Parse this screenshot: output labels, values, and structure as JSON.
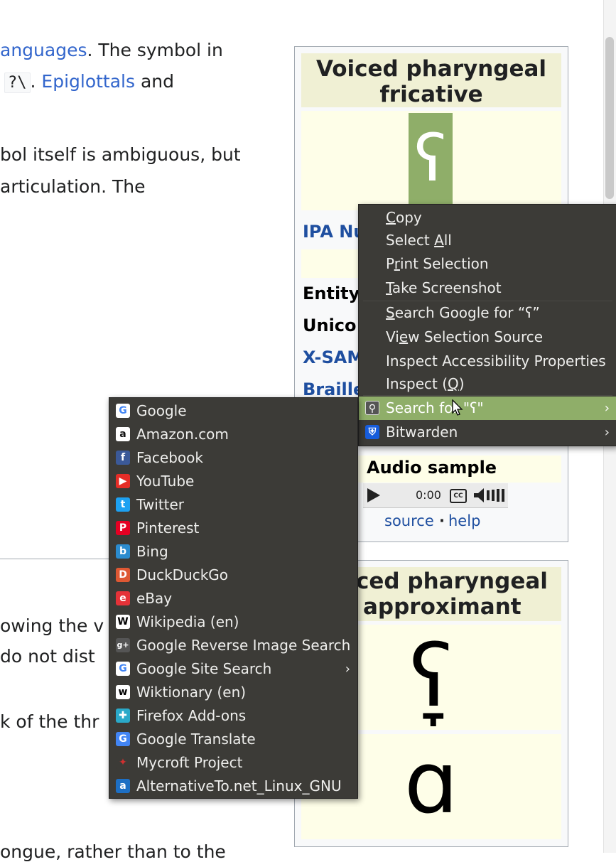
{
  "article": {
    "line1_link": "anguages",
    "line1_rest": ". The symbol in",
    "line2_code": "?\\",
    "line2_sep": ".",
    "line2_link": "Epiglottals",
    "line2_rest": "and",
    "line3": "bol itself is ambiguous, but",
    "line4": "articulation. The",
    "line5": "owing the v",
    "line6": "do not dist",
    "line7": "k of the thr",
    "line8": "ongue, rather than to the"
  },
  "infobox1": {
    "title": "Voiced pharyngeal fricative",
    "glyph": "ʕ",
    "labels": {
      "ipa_number": "IPA Nu",
      "entity": "Entity",
      "unicode": "Unico",
      "xsampa": "X-SAM",
      "braille": "Braille"
    },
    "audio_title": "Audio sample",
    "audio_time": "0:00",
    "audio_cc": "CC",
    "source": "source",
    "dot": "·",
    "help": "help"
  },
  "infobox2": {
    "title_line1": "ced pharyngeal",
    "title_line2": "approximant",
    "glyph1": "ʕ̞",
    "glyph2": "ɑ"
  },
  "context_menu": {
    "items": [
      {
        "prefix": "",
        "u": "C",
        "suffix": "opy"
      },
      {
        "prefix": "Select ",
        "u": "A",
        "suffix": "ll"
      },
      {
        "prefix": "P",
        "u": "r",
        "suffix": "int Selection"
      },
      {
        "prefix": "",
        "u": "T",
        "suffix": "ake Screenshot"
      },
      {
        "prefix": "",
        "u": "S",
        "suffix": "earch Google for “ʕ”"
      },
      {
        "prefix": "Vi",
        "u": "e",
        "suffix": "w Selection Source"
      },
      {
        "prefix": "Inspect Accessibility Properties",
        "u": "",
        "suffix": ""
      },
      {
        "prefix": "Inspect (",
        "u": "Q",
        "suffix": ")"
      }
    ],
    "search_for": "Search for \"ʕ\"",
    "bitwarden": "Bitwarden",
    "arrow": "›"
  },
  "search_submenu": {
    "engines": [
      {
        "label": "Google",
        "icon": "google-icon",
        "glyph": "G",
        "color": "#ffffff",
        "fg": "#4285f4"
      },
      {
        "label": "Amazon.com",
        "icon": "amazon-icon",
        "glyph": "a",
        "color": "#ffffff",
        "fg": "#111111"
      },
      {
        "label": "Facebook",
        "icon": "facebook-icon",
        "glyph": "f",
        "color": "#3b5998",
        "fg": "#ffffff"
      },
      {
        "label": "YouTube",
        "icon": "youtube-icon",
        "glyph": "▶",
        "color": "#e52d27",
        "fg": "#ffffff"
      },
      {
        "label": "Twitter",
        "icon": "twitter-icon",
        "glyph": "t",
        "color": "#1da1f2",
        "fg": "#ffffff"
      },
      {
        "label": "Pinterest",
        "icon": "pinterest-icon",
        "glyph": "P",
        "color": "#e60023",
        "fg": "#ffffff"
      },
      {
        "label": "Bing",
        "icon": "bing-icon",
        "glyph": "b",
        "color": "#2b8ccf",
        "fg": "#ffffff"
      },
      {
        "label": "DuckDuckGo",
        "icon": "duckduckgo-icon",
        "glyph": "D",
        "color": "#de5833",
        "fg": "#ffffff"
      },
      {
        "label": "eBay",
        "icon": "ebay-icon",
        "glyph": "e",
        "color": "#e53238",
        "fg": "#ffffff"
      },
      {
        "label": "Wikipedia (en)",
        "icon": "wikipedia-icon",
        "glyph": "W",
        "color": "#ffffff",
        "fg": "#000000"
      },
      {
        "label": "Google Reverse Image Search",
        "icon": "google-plus-icon",
        "glyph": "g+",
        "color": "#555555",
        "fg": "#ffffff"
      },
      {
        "label": "Google Site Search",
        "icon": "google-icon",
        "glyph": "G",
        "color": "#ffffff",
        "fg": "#4285f4"
      },
      {
        "label": "Wiktionary (en)",
        "icon": "wiktionary-icon",
        "glyph": "w",
        "color": "#ffffff",
        "fg": "#000000"
      },
      {
        "label": "Firefox Add-ons",
        "icon": "puzzle-icon",
        "glyph": "✚",
        "color": "#2aa9c9",
        "fg": "#ffffff"
      },
      {
        "label": "Google Translate",
        "icon": "google-translate-icon",
        "glyph": "G",
        "color": "#4285f4",
        "fg": "#ffffff"
      },
      {
        "label": "Mycroft Project",
        "icon": "mycroft-icon",
        "glyph": "✦",
        "color": "#3c3b37",
        "fg": "#d03030"
      },
      {
        "label": "AlternativeTo.net_Linux_GNU",
        "icon": "alternativeto-icon",
        "glyph": "a",
        "color": "#1d6fc4",
        "fg": "#ffffff"
      }
    ],
    "site_search_arrow": "›"
  },
  "colors": {
    "menu_bg": "#3c3b37",
    "menu_highlight": "#8fae69",
    "link": "#3366cc",
    "infobox_title_bg": "#f0f0d4"
  }
}
